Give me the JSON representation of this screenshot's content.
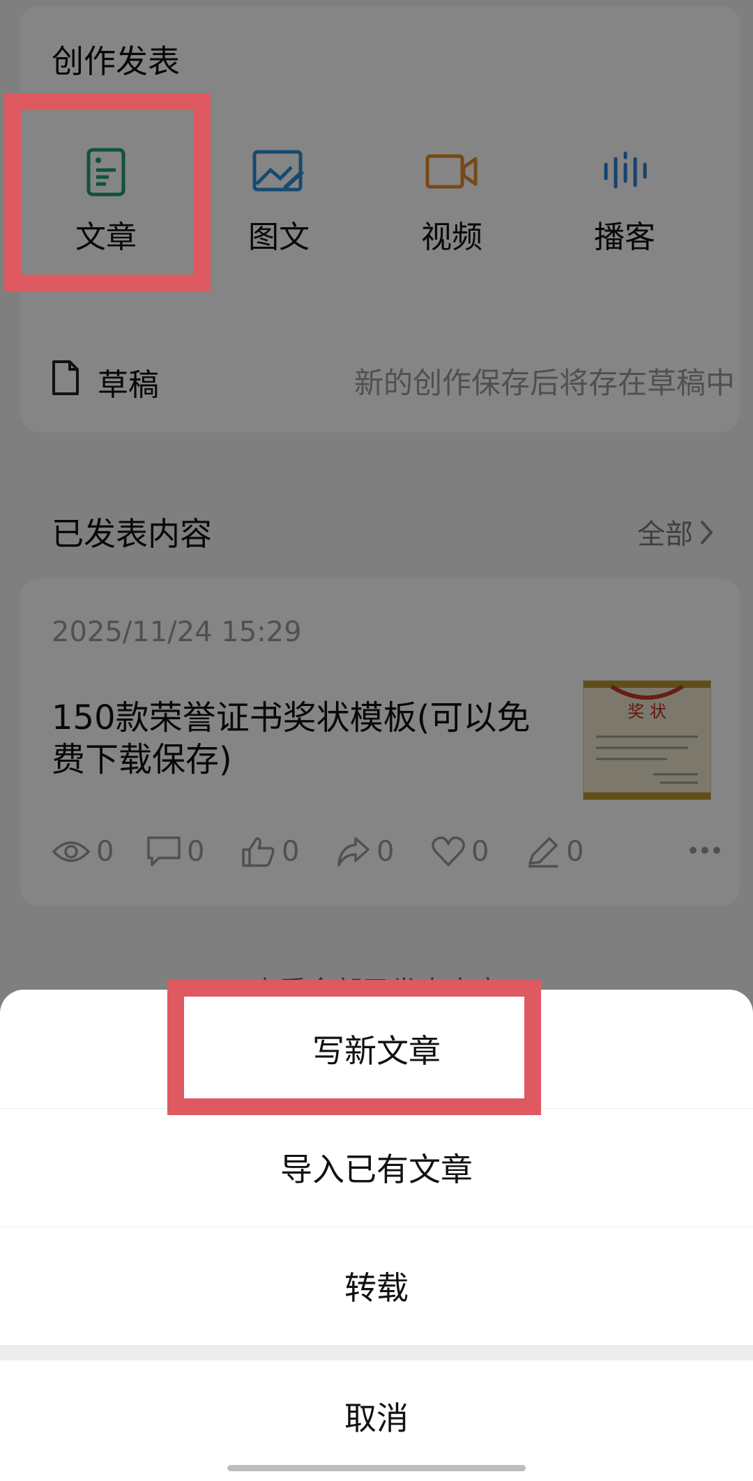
{
  "create": {
    "title": "创作发表",
    "tiles": [
      {
        "label": "文章",
        "icon": "article-icon",
        "color": "#1f9e6e"
      },
      {
        "label": "图文",
        "icon": "image-text-icon",
        "color": "#2b8fd6"
      },
      {
        "label": "视频",
        "icon": "video-icon",
        "color": "#e88a2c"
      },
      {
        "label": "播客",
        "icon": "podcast-icon",
        "color": "#2d7fd3"
      }
    ],
    "draft_label": "草稿",
    "draft_hint": "新的创作保存后将存在草稿中"
  },
  "published": {
    "title": "已发表内容",
    "all_label": "全部",
    "post": {
      "date": "2025/11/24 15:29",
      "title": "150款荣誉证书奖状模板(可以免费下载保存)",
      "thumb_heading": "奖 状",
      "stats": {
        "views": "0",
        "comments": "0",
        "likes": "0",
        "shares": "0",
        "favorites": "0",
        "edits": "0"
      }
    },
    "view_all_label": "查看全部已发表内容"
  },
  "sheet": {
    "items": [
      "写新文章",
      "导入已有文章",
      "转载"
    ],
    "cancel": "取消"
  },
  "colors": {
    "highlight": "#de5a60",
    "overlay": "rgba(0,0,0,0.48)"
  }
}
